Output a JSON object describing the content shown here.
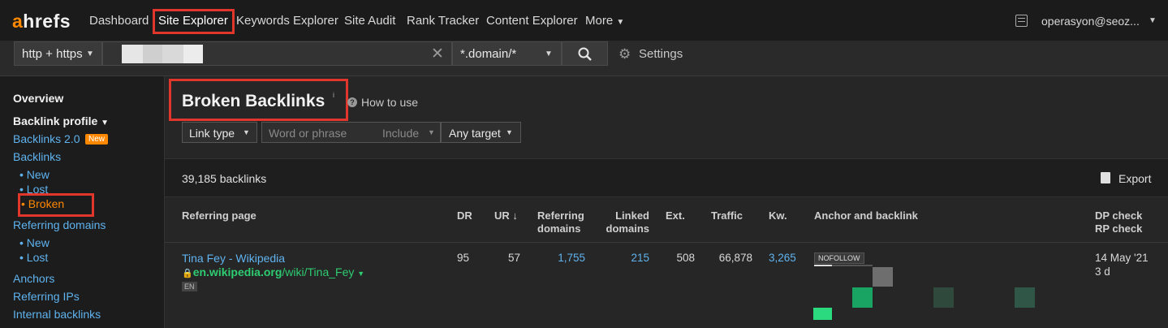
{
  "logo": {
    "text_a": "a",
    "text_rest": "hrefs"
  },
  "nav": {
    "dashboard": "Dashboard",
    "site_explorer": "Site Explorer",
    "keywords_explorer": "Keywords Explorer",
    "site_audit": "Site Audit",
    "rank_tracker": "Rank Tracker",
    "content_explorer": "Content Explorer",
    "more": "More",
    "user": "operasyon@seoz..."
  },
  "toolbar": {
    "protocol": "http + https",
    "url_value": "",
    "mode": "*.domain/*",
    "settings": "Settings"
  },
  "sidebar": {
    "overview": "Overview",
    "backlink_profile": "Backlink profile",
    "backlinks_2": "Backlinks 2.0",
    "new_badge": "New",
    "backlinks": "Backlinks",
    "bl_new": "New",
    "bl_lost": "Lost",
    "bl_broken": "Broken",
    "referring_domains": "Referring domains",
    "rd_new": "New",
    "rd_lost": "Lost",
    "anchors": "Anchors",
    "referring_ips": "Referring IPs",
    "internal_backlinks": "Internal backlinks"
  },
  "page": {
    "title": "Broken Backlinks",
    "how_to_use": "How to use",
    "filter_link_type": "Link type",
    "filter_placeholder": "Word or phrase",
    "filter_include": "Include",
    "filter_target": "Any target",
    "count": "39,185 backlinks",
    "export": "Export"
  },
  "table": {
    "headers": {
      "referring_page": "Referring page",
      "dr": "DR",
      "ur": "UR",
      "ref_domains_1": "Referring",
      "ref_domains_2": "domains",
      "linked_domains_1": "Linked",
      "linked_domains_2": "domains",
      "ext": "Ext.",
      "traffic": "Traffic",
      "kw": "Kw.",
      "anchor": "Anchor and backlink",
      "dp_check": "DP check",
      "rp_check": "RP check"
    },
    "rows": [
      {
        "title": "Tina Fey - Wikipedia",
        "url_domain": "en.wikipedia.org",
        "url_path": "/wiki/Tina_Fey",
        "lang": "EN",
        "dr": "95",
        "ur": "57",
        "ref_domains": "1,755",
        "linked_domains": "215",
        "ext": "508",
        "traffic": "66,878",
        "kw": "3,265",
        "nofollow": "NOFOLLOW",
        "dp_date": "14 May '21",
        "rp_ago": "3 d"
      }
    ]
  },
  "colors": {
    "accent": "#ff8800",
    "link": "#5fb3ef",
    "url_green": "#2ecc71",
    "highlight": "#e0362c"
  }
}
